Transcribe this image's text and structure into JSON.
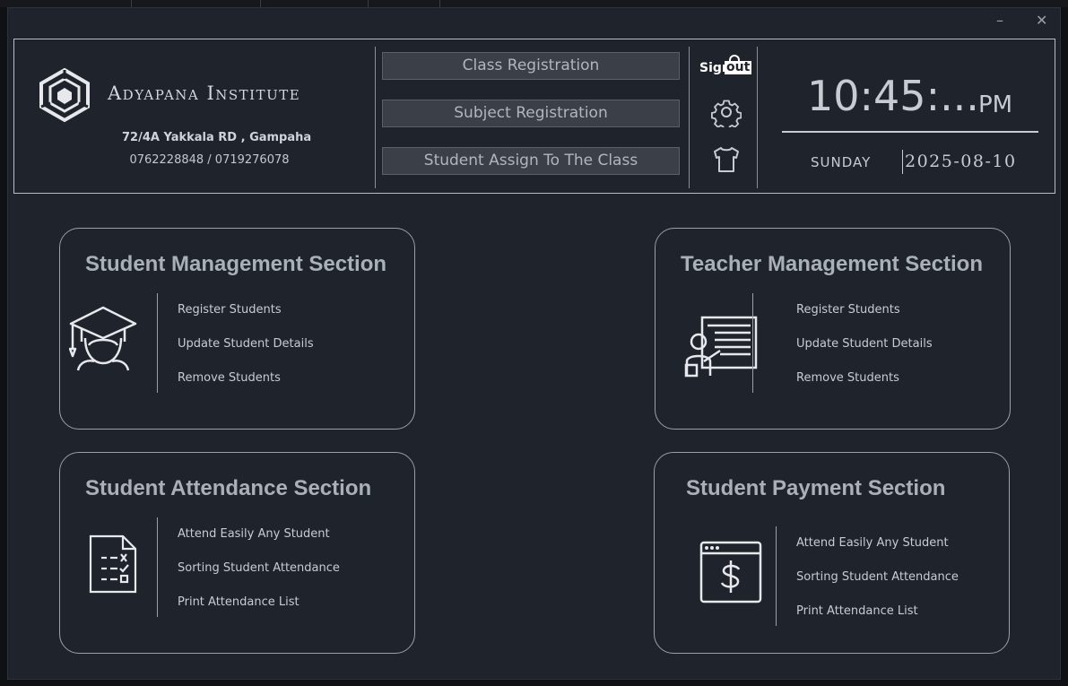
{
  "institute": {
    "name": "Adyapana Institute",
    "address": "72/4A Yakkala RD , Gampaha",
    "phones": "0762228848 / 0719276078"
  },
  "nav": {
    "class_registration": "Class Registration",
    "subject_registration": "Subject Registration",
    "student_assign": "Student Assign To The Class"
  },
  "actions": {
    "sign_label": "Sign",
    "out_label": "out"
  },
  "clock": {
    "time": "10:45:...",
    "ampm": "PM",
    "day": "SUNDAY",
    "date": "2025-08-10"
  },
  "window": {
    "minimize": "–",
    "close": "✕"
  },
  "cards": {
    "student_management": {
      "title": "Student Management Section",
      "icon": "graduate-student-icon",
      "links": [
        "Register Students",
        "Update Student Details",
        "Remove Students"
      ]
    },
    "teacher_management": {
      "title": "Teacher Management Section",
      "icon": "teacher-board-icon",
      "links": [
        "Register Students",
        "Update Student Details",
        "Remove Students"
      ]
    },
    "student_attendance": {
      "title": "Student Attendance Section",
      "icon": "checklist-icon",
      "links": [
        "Attend Easily Any Student",
        "Sorting Student Attendance",
        "Print Attendance List"
      ]
    },
    "student_payment": {
      "title": "Student Payment Section",
      "icon": "payment-window-icon",
      "links": [
        "Attend Easily Any Student",
        "Sorting Student Attendance",
        "Print Attendance List"
      ]
    }
  },
  "colors": {
    "background": "#1f232b",
    "outer": "#0f1115",
    "button": "#3a3f48",
    "card_border": "#9aa0a8",
    "title_text": "#a9b0ba"
  }
}
